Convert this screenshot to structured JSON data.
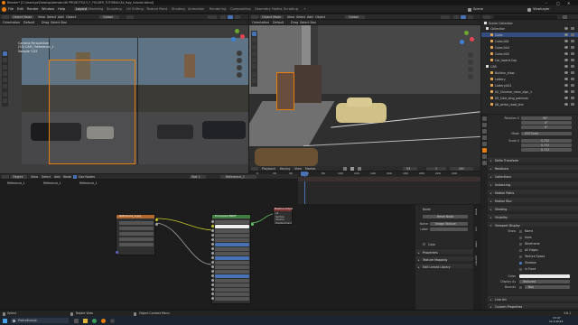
{
  "window": {
    "title": "Blender* [C:\\Users\\pc\\Desktop\\blender\\4K PROJECTS\\13_F_FOLDER_TUTORIAL\\3d_fspy_tutorial.blend]"
  },
  "menus": [
    "File",
    "Edit",
    "Render",
    "Window",
    "Help"
  ],
  "workspaces": [
    "Layout",
    "Modeling",
    "Sculpting",
    "UV Editing",
    "Texture Paint",
    "Shading",
    "Animation",
    "Rendering",
    "Compositing",
    "Geometry Nodes",
    "Scripting"
  ],
  "active_workspace": "Layout",
  "scene": {
    "label": "Scene",
    "view_layer": "ViewLayer"
  },
  "left_viewport": {
    "mode": "Object Mode",
    "menus": [
      "View",
      "Select",
      "Add",
      "Object"
    ],
    "orientation": "Global",
    "overlay_text": [
      "Camera Perspective",
      "(53) CAR | Reference_1",
      "Sample 7/32"
    ],
    "tool_header": [
      "Orientation",
      "Default",
      "Drag",
      "Select Box"
    ]
  },
  "right_viewport": {
    "mode": "Object Mode",
    "menus": [
      "View",
      "Select",
      "Add",
      "Object"
    ],
    "orientation": "Global",
    "tool_header": [
      "Orientation",
      "Default",
      "Drag",
      "Select Box"
    ]
  },
  "outliner": {
    "title": "Scene Collection",
    "items": [
      {
        "label": "Collection",
        "indent": 1
      },
      {
        "label": "Cube",
        "indent": 2
      },
      {
        "label": "Cube.001",
        "indent": 2
      },
      {
        "label": "Cube.004",
        "indent": 2
      },
      {
        "label": "Cube.005",
        "indent": 2
      },
      {
        "label": "Car_board.Cap",
        "indent": 2
      },
      {
        "label": "CAR",
        "indent": 1
      },
      {
        "label": "Buildsn_shop",
        "indent": 2
      },
      {
        "label": "Lottery",
        "indent": 2
      },
      {
        "label": "Lottery.001",
        "indent": 2
      },
      {
        "label": "02_Chinese_neon_sign_1",
        "indent": 2
      },
      {
        "label": "05_Cole_sing_paintola",
        "indent": 2
      },
      {
        "label": "06_white_road_line",
        "indent": 2
      }
    ]
  },
  "properties": {
    "rotation_label": "Rotation X",
    "rotation": [
      "90°",
      "0°",
      "0°"
    ],
    "mode_label": "Mode",
    "mode_value": "XYZ Euler",
    "scale_label": "Scale X",
    "scale": [
      "0.722",
      "0.722",
      "0.722"
    ],
    "sections": [
      "Delta Transform",
      "Relations",
      "Collections",
      "Instancing",
      "Motion Paths",
      "Motion Blur",
      "Shading",
      "Visibility",
      "Viewport Display"
    ],
    "viewport_display": {
      "show_label": "Show",
      "checks": [
        "Name",
        "Axes",
        "Wireframe",
        "All Edges",
        "Texture Space",
        "Shadow",
        "In Front"
      ],
      "checked": [
        false,
        false,
        false,
        false,
        false,
        true,
        false
      ],
      "color_label": "Color",
      "display_as_label": "Display As",
      "display_as_value": "Textured",
      "bounds_label": "Bounds",
      "bounds_value": "Box"
    },
    "bottom_sections": [
      "Line Art",
      "Custom Properties"
    ]
  },
  "timeline": {
    "menus": [
      "Playback",
      "Keying",
      "View",
      "Marker"
    ],
    "summary": "Summary",
    "ticks": [
      "0",
      "20",
      "40",
      "60",
      "80",
      "100",
      "120",
      "140",
      "160",
      "180",
      "200",
      "220",
      "240"
    ],
    "current_frame": "53",
    "start": "1",
    "end": "250"
  },
  "node_editor": {
    "header": [
      "Object",
      "View",
      "Select",
      "Add",
      "Node",
      "Use Nodes"
    ],
    "slot": "Slot 1",
    "material": "Reference_1",
    "breadcrumb": [
      "Reference_1",
      "Reference_1",
      "Reference_1"
    ],
    "image_node_title": "Reference_1.jpg",
    "bsdf_title": "Principled BSDF",
    "output_title": "Material Output",
    "output_sockets": [
      "All",
      "Surface",
      "Volume",
      "Displacement"
    ]
  },
  "image_panel": {
    "node_label": "Node",
    "reset_label": "Reset Node",
    "name_label": "Name",
    "name_value": "Image Texture",
    "label_label": "Label",
    "color_label": "Color",
    "sections": [
      "Properties",
      "Texture Mapping",
      "Edit Linked Library"
    ],
    "tabs": [
      "Node",
      "Tool",
      "View",
      "Options"
    ]
  },
  "status": {
    "left": [
      "Select",
      "Rotate View",
      "Object Context Menu"
    ],
    "right": "3.6.1"
  },
  "taskbar": {
    "search": "Pretraživanje",
    "time": "13:47",
    "date": "12.4.2023."
  },
  "colors": {
    "accent": "#4772b3",
    "header": "#2b2b2b",
    "panel": "#282828",
    "selected": "#334d80"
  }
}
